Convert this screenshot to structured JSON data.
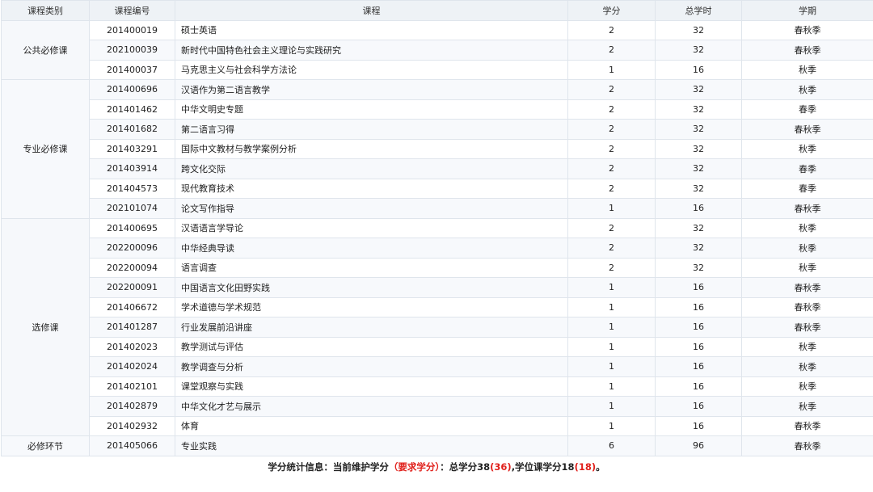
{
  "table": {
    "headers": [
      "课程类别",
      "课程编号",
      "课程",
      "学分",
      "总学时",
      "学期"
    ],
    "groups": [
      {
        "category": "公共必修课",
        "rows": [
          {
            "code": "201400019",
            "course": "硕士英语",
            "credit": "2",
            "hours": "32",
            "term": "春秋季"
          },
          {
            "code": "202100039",
            "course": "新时代中国特色社会主义理论与实践研究",
            "credit": "2",
            "hours": "32",
            "term": "春秋季"
          },
          {
            "code": "201400037",
            "course": "马克思主义与社会科学方法论",
            "credit": "1",
            "hours": "16",
            "term": "秋季"
          }
        ]
      },
      {
        "category": "专业必修课",
        "rows": [
          {
            "code": "201400696",
            "course": "汉语作为第二语言教学",
            "credit": "2",
            "hours": "32",
            "term": "秋季"
          },
          {
            "code": "201401462",
            "course": "中华文明史专题",
            "credit": "2",
            "hours": "32",
            "term": "春季"
          },
          {
            "code": "201401682",
            "course": "第二语言习得",
            "credit": "2",
            "hours": "32",
            "term": "春秋季"
          },
          {
            "code": "201403291",
            "course": "国际中文教材与教学案例分析",
            "credit": "2",
            "hours": "32",
            "term": "秋季"
          },
          {
            "code": "201403914",
            "course": "跨文化交际",
            "credit": "2",
            "hours": "32",
            "term": "春季"
          },
          {
            "code": "201404573",
            "course": "现代教育技术",
            "credit": "2",
            "hours": "32",
            "term": "春季"
          },
          {
            "code": "202101074",
            "course": "论文写作指导",
            "credit": "1",
            "hours": "16",
            "term": "春秋季"
          }
        ]
      },
      {
        "category": "选修课",
        "rows": [
          {
            "code": "201400695",
            "course": "汉语语言学导论",
            "credit": "2",
            "hours": "32",
            "term": "秋季"
          },
          {
            "code": "202200096",
            "course": "中华经典导读",
            "credit": "2",
            "hours": "32",
            "term": "秋季"
          },
          {
            "code": "202200094",
            "course": "语言调查",
            "credit": "2",
            "hours": "32",
            "term": "秋季"
          },
          {
            "code": "202200091",
            "course": "中国语言文化田野实践",
            "credit": "1",
            "hours": "16",
            "term": "春秋季"
          },
          {
            "code": "201406672",
            "course": "学术道德与学术规范",
            "credit": "1",
            "hours": "16",
            "term": "春秋季"
          },
          {
            "code": "201401287",
            "course": "行业发展前沿讲座",
            "credit": "1",
            "hours": "16",
            "term": "春秋季"
          },
          {
            "code": "201402023",
            "course": "教学测试与评估",
            "credit": "1",
            "hours": "16",
            "term": "秋季"
          },
          {
            "code": "201402024",
            "course": "教学调查与分析",
            "credit": "1",
            "hours": "16",
            "term": "秋季"
          },
          {
            "code": "201402101",
            "course": "课堂观察与实践",
            "credit": "1",
            "hours": "16",
            "term": "秋季"
          },
          {
            "code": "201402879",
            "course": "中华文化才艺与展示",
            "credit": "1",
            "hours": "16",
            "term": "秋季"
          },
          {
            "code": "201402932",
            "course": "体育",
            "credit": "1",
            "hours": "16",
            "term": "春秋季"
          }
        ]
      },
      {
        "category": "必修环节",
        "rows": [
          {
            "code": "201405066",
            "course": "专业实践",
            "credit": "6",
            "hours": "96",
            "term": "春秋季"
          }
        ]
      }
    ]
  },
  "summary": {
    "prefix": "学分统计信息：当前维护学分",
    "required_label": "（要求学分）",
    "middle": "：总学分38",
    "total_required": "(36)",
    "degree_text": ",学位课学分18",
    "degree_required": "(18)",
    "suffix": "。"
  }
}
